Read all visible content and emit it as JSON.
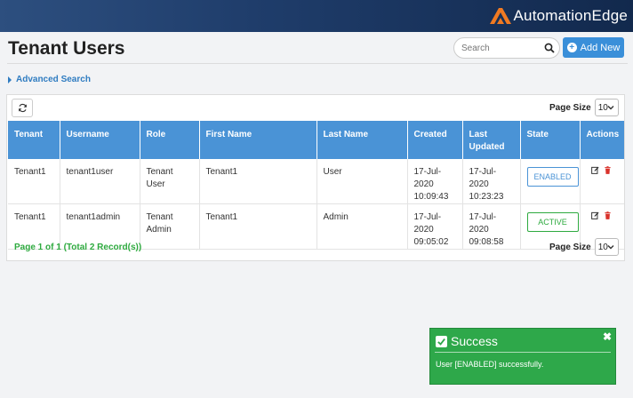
{
  "brand": {
    "name": "AutomationEdge"
  },
  "header": {
    "title": "Tenant Users",
    "search_placeholder": "Search",
    "add_new_label": "Add New",
    "advanced_search_label": "Advanced Search"
  },
  "pagination": {
    "page_size_label": "Page Size",
    "page_size_value": "10",
    "summary": "Page 1 of 1 (Total 2 Record(s))"
  },
  "table": {
    "columns": [
      "Tenant",
      "Username",
      "Role",
      "First Name",
      "Last Name",
      "Created",
      "Last Updated",
      "State",
      "Actions"
    ],
    "rows": [
      {
        "tenant": "Tenant1",
        "username": "tenant1user",
        "role": "Tenant User",
        "first_name": "Tenant1",
        "last_name": "User",
        "created": "17-Jul-2020 10:09:43",
        "last_updated": "17-Jul-2020 10:23:23",
        "state": "ENABLED"
      },
      {
        "tenant": "Tenant1",
        "username": "tenant1admin",
        "role": "Tenant Admin",
        "first_name": "Tenant1",
        "last_name": "Admin",
        "created": "17-Jul-2020 09:05:02",
        "last_updated": "17-Jul-2020 09:08:58",
        "state": "ACTIVE"
      }
    ]
  },
  "toast": {
    "title": "Success",
    "message": "User [ENABLED] successfully.",
    "close_glyph": "✖"
  },
  "colors": {
    "accent": "#3a8fd9",
    "table_header": "#4a93d6",
    "success": "#2ea84a",
    "logo_orange": "#f07a22"
  }
}
